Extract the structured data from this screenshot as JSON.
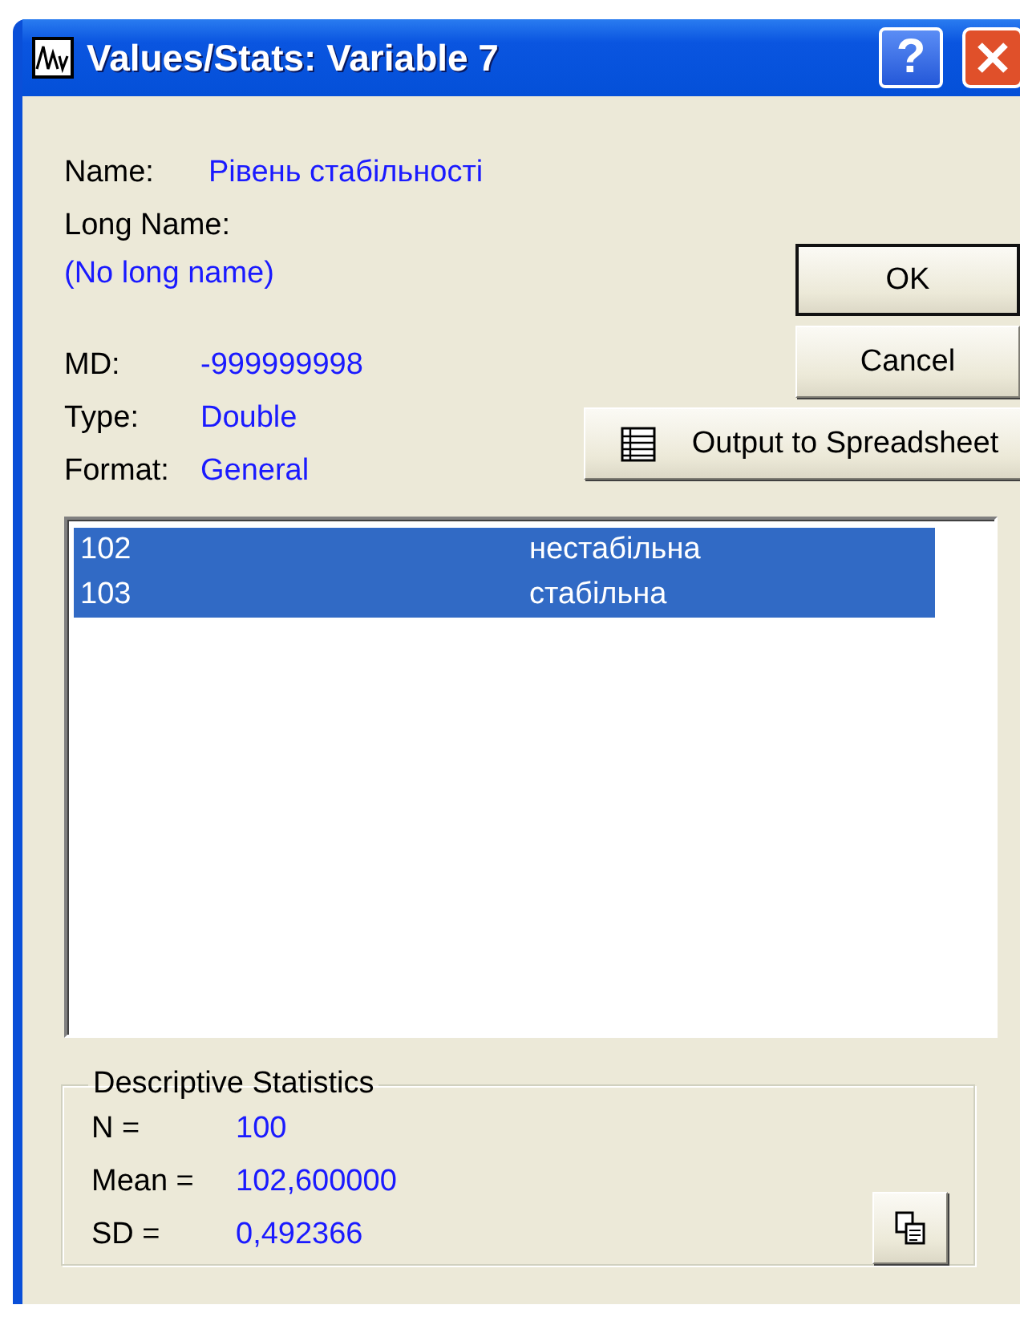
{
  "window": {
    "title": "Values/Stats: Variable 7"
  },
  "help_button": {
    "label": "?"
  },
  "name": {
    "label": "Name:",
    "value": "Рівень стабільності"
  },
  "long_name": {
    "label": "Long Name:",
    "value": "(No long name)"
  },
  "md": {
    "label": "MD:",
    "value": "-999999998"
  },
  "type": {
    "label": "Type:",
    "value": "Double"
  },
  "format": {
    "label": "Format:",
    "value": "General"
  },
  "buttons": [
    {
      "label": "OK",
      "default": true
    },
    {
      "label": "Cancel",
      "default": false
    }
  ],
  "output_button": {
    "label": "Output to Spreadsheet"
  },
  "values_list": [
    {
      "code": "102",
      "label": "нестабільна",
      "selected": true
    },
    {
      "code": "103",
      "label": "стабільна",
      "selected": true
    }
  ],
  "descriptive_statistics": {
    "title": "Descriptive Statistics",
    "rows": [
      {
        "label": "N =",
        "value": "100"
      },
      {
        "label": "Mean =",
        "value": "102,600000"
      },
      {
        "label": "SD =",
        "value": "0,492366"
      }
    ]
  }
}
